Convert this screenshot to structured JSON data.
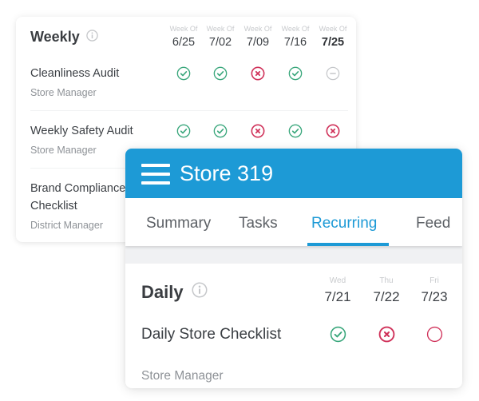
{
  "weekly": {
    "title": "Weekly",
    "info_icon": "info-icon",
    "weeks": [
      {
        "label": "Week Of",
        "date": "6/25"
      },
      {
        "label": "Week Of",
        "date": "7/02"
      },
      {
        "label": "Week Of",
        "date": "7/09"
      },
      {
        "label": "Week Of",
        "date": "7/16"
      },
      {
        "label": "Week Of",
        "date": "7/25"
      }
    ],
    "tasks": [
      {
        "name": "Cleanliness Audit",
        "role": "Store Manager",
        "statuses": [
          "complete",
          "complete",
          "missed",
          "complete",
          "pending"
        ]
      },
      {
        "name": "Weekly Safety Audit",
        "role": "Store Manager",
        "statuses": [
          "complete",
          "complete",
          "missed",
          "complete",
          "missed"
        ]
      },
      {
        "name_line1": "Brand Compliance",
        "name_line2": "Checklist",
        "role": "District Manager"
      }
    ]
  },
  "store": {
    "menu_icon": "hamburger-menu-icon",
    "title": "Store 319",
    "tabs": [
      {
        "label": "Summary",
        "active": false
      },
      {
        "label": "Tasks",
        "active": false
      },
      {
        "label": "Recurring",
        "active": true
      },
      {
        "label": "Feed",
        "active": false
      }
    ],
    "daily": {
      "title": "Daily",
      "info_icon": "info-icon",
      "days": [
        {
          "label": "Wed",
          "date": "7/21"
        },
        {
          "label": "Thu",
          "date": "7/22"
        },
        {
          "label": "Fri",
          "date": "7/23"
        }
      ],
      "tasks": [
        {
          "name": "Daily Store Checklist",
          "role": "Store Manager",
          "statuses": [
            "complete",
            "missed",
            "open"
          ]
        }
      ]
    }
  },
  "colors": {
    "brand_blue": "#1d9ad6",
    "complete_green": "#3aa77c",
    "missed_red": "#d0325a",
    "pending_gray": "#c5c7ca"
  }
}
